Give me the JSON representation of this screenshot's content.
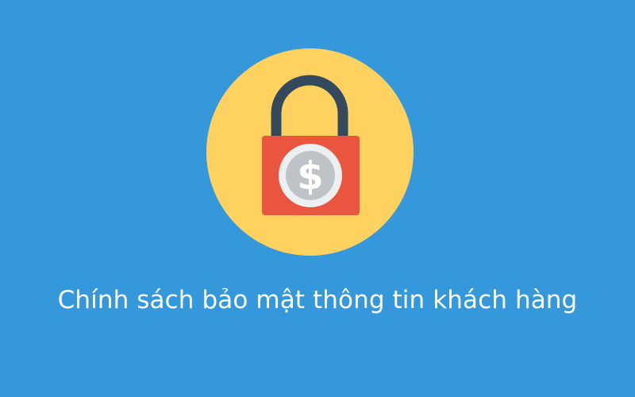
{
  "banner": {
    "title": "Chính sách bảo mật thông tin khách hàng",
    "icon": "padlock-dollar-icon",
    "colors": {
      "background": "#3498db",
      "circle": "#ffd25f",
      "shackle": "#34495e",
      "lock_body": "#e9553f",
      "coin_outer": "#ecf0f1",
      "coin_inner": "#bdc3c7",
      "dollar_sign": "#ffffff"
    }
  }
}
